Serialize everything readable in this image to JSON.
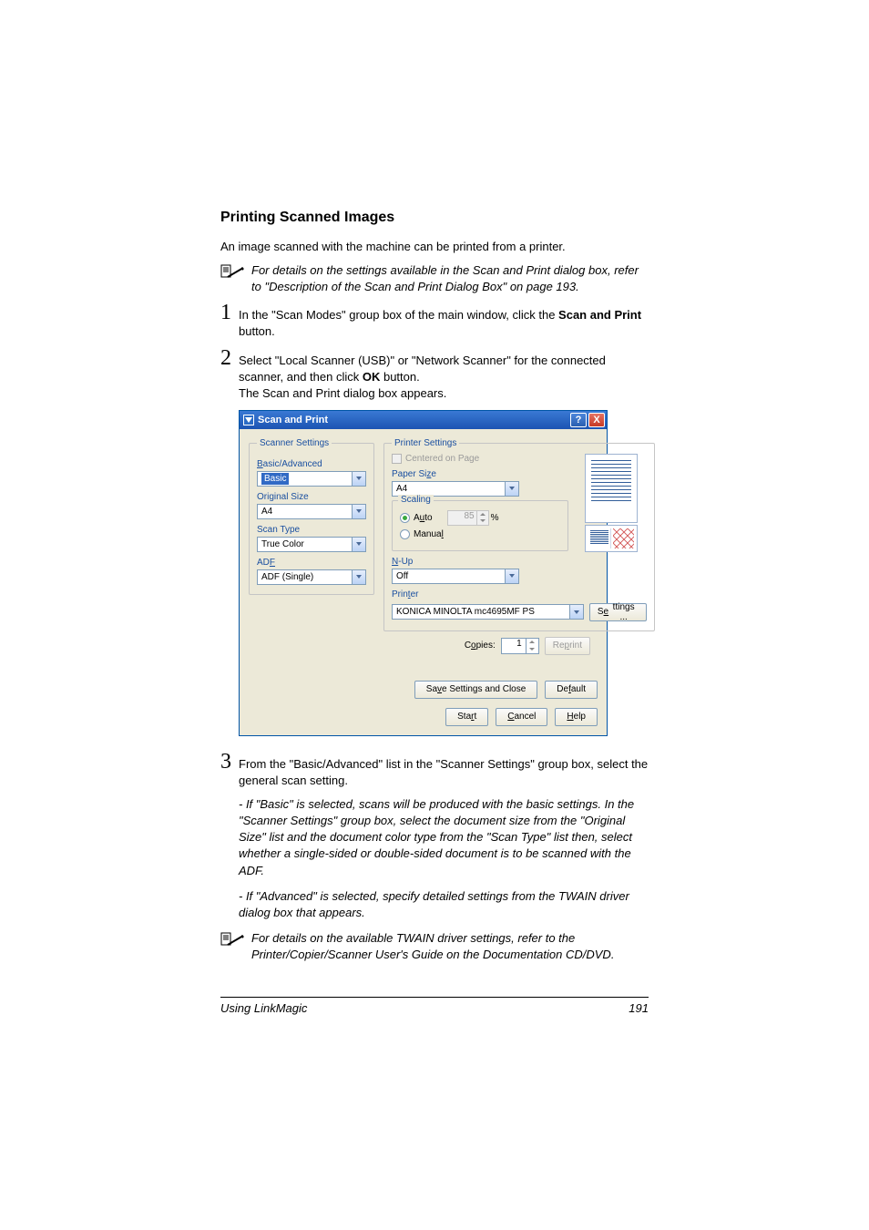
{
  "heading": "Printing Scanned Images",
  "intro": "An image scanned with the machine can be printed from a printer.",
  "note1": "For details on the settings available in the Scan and Print dialog box, refer to \"Description of the Scan and Print Dialog Box\" on page 193.",
  "steps": {
    "s1_num": "1",
    "s1_a": "In the \"Scan Modes\" group box of the main window, click the ",
    "s1_b": "Scan and Print",
    "s1_c": " button.",
    "s2_num": "2",
    "s2_a": "Select \"Local Scanner (USB)\" or \"Network Scanner\" for the connected scanner, and then click ",
    "s2_b": "OK",
    "s2_c": " button.",
    "s2_d": "The Scan and Print dialog box appears.",
    "s3_num": "3",
    "s3": "From the \"Basic/Advanced\" list in the \"Scanner Settings\" group box, select the general scan setting.",
    "s3_note_a": "- If \"Basic\" is selected, scans will be produced with the basic settings. In the \"Scanner Settings\" group box, select the document size from the \"Original Size\" list and the document color type from the \"Scan Type\" list then, select whether a single-sided or double-sided document is to be scanned with the ADF.",
    "s3_note_b": "- If \"Advanced\" is selected, specify detailed settings from the TWAIN driver dialog box that appears."
  },
  "note2": "For details on the available TWAIN driver settings, refer to the Printer/Copier/Scanner User's Guide on the Documentation CD/DVD.",
  "dialog": {
    "title": "Scan and Print",
    "help": "?",
    "close": "X",
    "scanner_legend": "Scanner Settings",
    "ba_label": "Basic/Advanced",
    "ba_value": "Basic",
    "os_label": "Original Size",
    "os_value": "A4",
    "st_label": "Scan Type",
    "st_value": "True Color",
    "adf_label": "ADF",
    "adf_value": "ADF (Single)",
    "printer_legend": "Printer Settings",
    "centered": "Centered on Page",
    "paper_size_label": "Paper Size",
    "paper_size_value": "A4",
    "scaling_label": "Scaling",
    "auto_label": "Auto",
    "manual_label": "Manual",
    "pct_val": "85",
    "pct_unit": "%",
    "nup_label": "N-Up",
    "nup_value": "Off",
    "printer_label": "Printer",
    "printer_value": "KONICA MINOLTA mc4695MF PS",
    "settings_btn": "Settings ...",
    "copies_label": "Copies:",
    "copies_value": "1",
    "reprint_btn": "Reprint",
    "save_close_btn": "Save Settings and Close",
    "default_btn": "Default",
    "start_btn": "Start",
    "cancel_btn": "Cancel",
    "help_btn": "Help"
  },
  "footer_left": "Using LinkMagic",
  "footer_right": "191"
}
